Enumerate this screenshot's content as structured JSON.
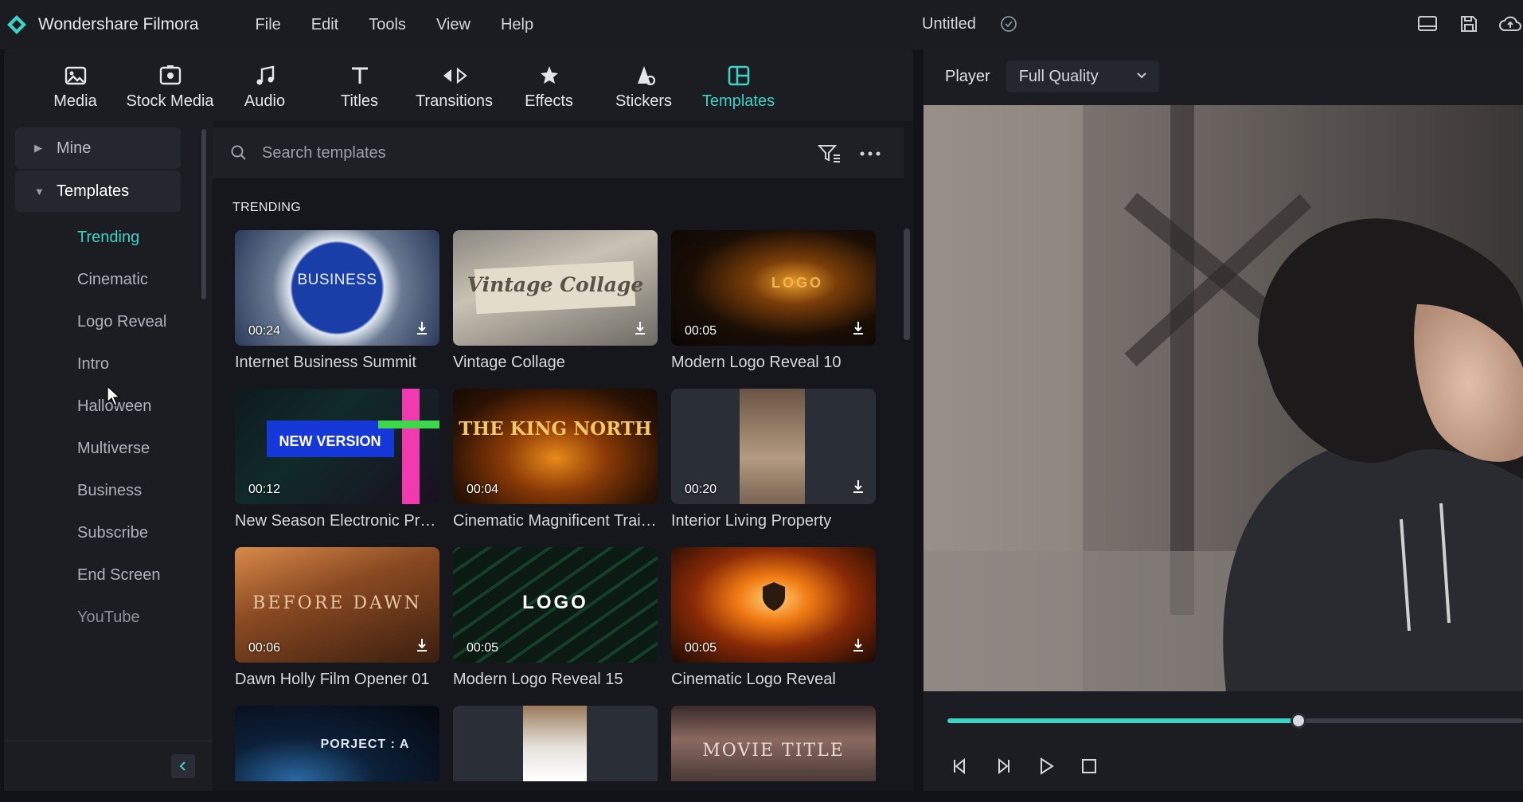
{
  "app": {
    "name": "Wondershare Filmora",
    "document_title": "Untitled",
    "menu": [
      "File",
      "Edit",
      "Tools",
      "View",
      "Help"
    ]
  },
  "toolbar": {
    "items": [
      {
        "label": "Media",
        "icon": "media-icon"
      },
      {
        "label": "Stock Media",
        "icon": "stock-media-icon"
      },
      {
        "label": "Audio",
        "icon": "music-note-icon"
      },
      {
        "label": "Titles",
        "icon": "text-t-icon"
      },
      {
        "label": "Transitions",
        "icon": "transitions-icon"
      },
      {
        "label": "Effects",
        "icon": "effects-icon"
      },
      {
        "label": "Stickers",
        "icon": "stickers-icon"
      },
      {
        "label": "Templates",
        "icon": "templates-icon",
        "active": true
      }
    ]
  },
  "sidebar": {
    "groups": [
      {
        "label": "Mine",
        "expanded": false
      },
      {
        "label": "Templates",
        "expanded": true
      }
    ],
    "items": [
      "Trending",
      "Cinematic",
      "Logo Reveal",
      "Intro",
      "Halloween",
      "Multiverse",
      "Business",
      "Subscribe",
      "End Screen",
      "YouTube"
    ],
    "active_item": "Trending"
  },
  "search": {
    "placeholder": "Search templates"
  },
  "section": {
    "title": "TRENDING"
  },
  "templates": [
    {
      "title": "Internet Business Summit",
      "duration": "00:24",
      "thumb_text": "BUSINESS"
    },
    {
      "title": "Vintage Collage",
      "duration": "",
      "thumb_text": "Vintage Collage"
    },
    {
      "title": "Modern Logo Reveal 10",
      "duration": "00:05",
      "thumb_text": "LOGO"
    },
    {
      "title": "New Season Electronic Prod...",
      "duration": "00:12",
      "thumb_text": "NEW VERSION"
    },
    {
      "title": "Cinematic Magnificent Trailer",
      "duration": "00:04",
      "thumb_text": "THE KING NORTH"
    },
    {
      "title": "Interior Living Property",
      "duration": "00:20",
      "thumb_text": ""
    },
    {
      "title": "Dawn Holly Film Opener 01",
      "duration": "00:06",
      "thumb_text": "BEFORE DAWN"
    },
    {
      "title": "Modern Logo Reveal 15",
      "duration": "00:05",
      "thumb_text": "LOGO"
    },
    {
      "title": "Cinematic Logo Reveal",
      "duration": "00:05",
      "thumb_text": ""
    },
    {
      "title": "",
      "duration": "",
      "thumb_text": "PORJECT : A"
    },
    {
      "title": "",
      "duration": "",
      "thumb_text": ""
    },
    {
      "title": "",
      "duration": "",
      "thumb_text": "MOVIE TITLE"
    }
  ],
  "player": {
    "label": "Player",
    "quality": "Full Quality",
    "progress": 0.61
  },
  "colors": {
    "accent": "#3ed2c5",
    "background": "#111318",
    "panel": "#1b1d23"
  }
}
